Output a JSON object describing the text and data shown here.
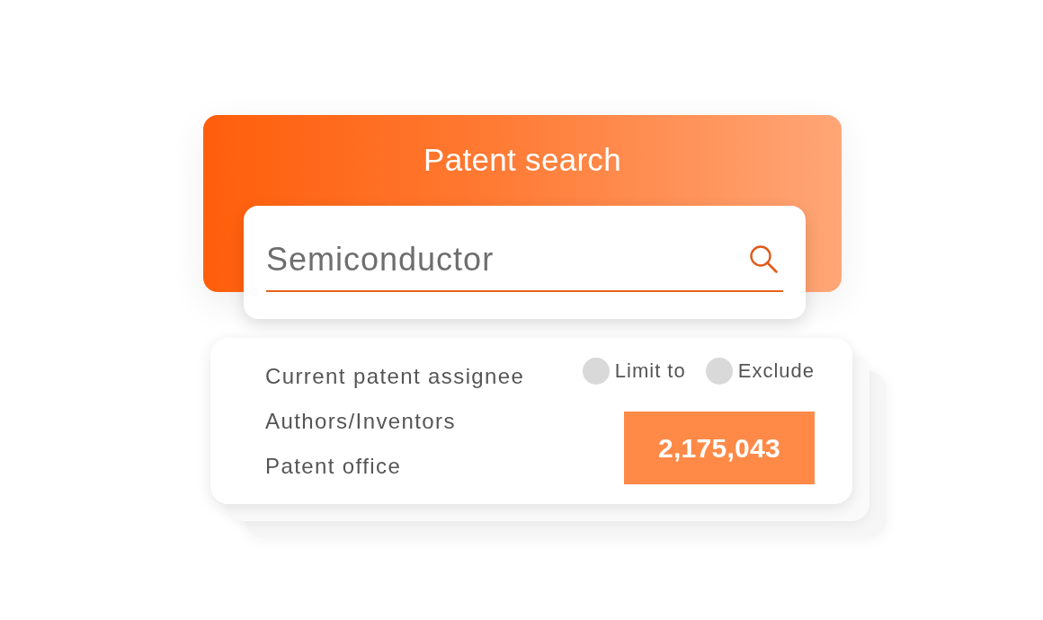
{
  "header": {
    "title": "Patent search"
  },
  "search": {
    "value": "Semiconductor"
  },
  "filters": {
    "fields": [
      {
        "label": "Current patent assignee"
      },
      {
        "label": "Authors/Inventors"
      },
      {
        "label": "Patent office"
      }
    ],
    "options": [
      {
        "label": "Limit to",
        "selected": false
      },
      {
        "label": "Exclude",
        "selected": false
      }
    ],
    "result_count": "2,175,043"
  }
}
